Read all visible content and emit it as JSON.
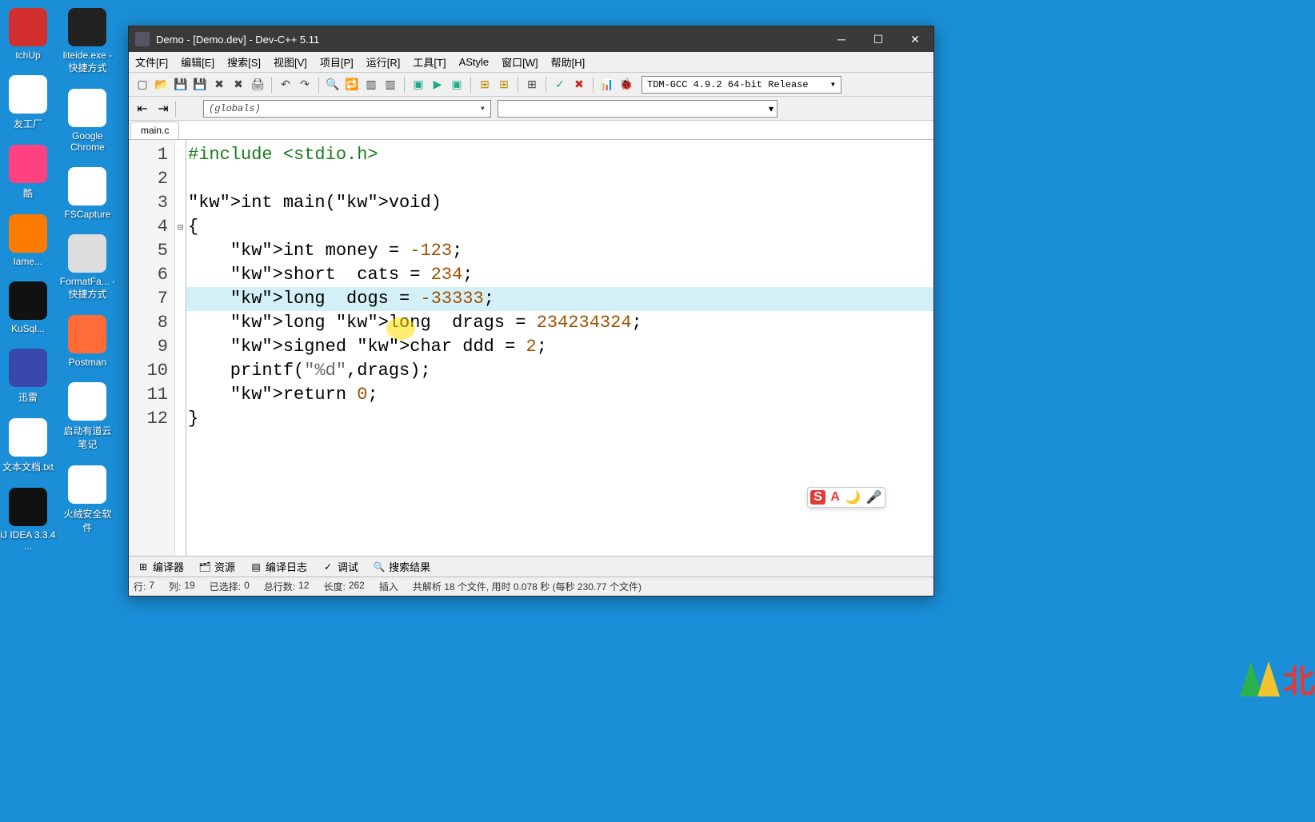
{
  "desktop": {
    "col1": [
      {
        "label": "tchUp",
        "color": "#d32f2f"
      },
      {
        "label": "友工厂",
        "color": "#ffffff"
      },
      {
        "label": "酷",
        "color": "#ff4081"
      },
      {
        "label": "lame...",
        "color": "#ff7b00"
      },
      {
        "label": "KuSql...",
        "color": "#111"
      },
      {
        "label": "迅雷",
        "color": "#3949ab"
      },
      {
        "label": "文本文档.txt",
        "color": "#fff"
      },
      {
        "label": "iJ IDEA 3.3.4 ...",
        "color": "#111"
      }
    ],
    "col2": [
      {
        "label": "liteide.exe - 快捷方式",
        "color": "#222"
      },
      {
        "label": "Google Chrome",
        "color": "#fff"
      },
      {
        "label": "FSCapture",
        "color": "#fff"
      },
      {
        "label": "FormatFa... - 快捷方式",
        "color": "#ddd"
      },
      {
        "label": "Postman",
        "color": "#ff6c37"
      },
      {
        "label": "启动有道云笔记",
        "color": "#fff"
      },
      {
        "label": "火绒安全软件",
        "color": "#fff"
      }
    ]
  },
  "ide": {
    "title": "Demo - [Demo.dev] - Dev-C++ 5.11",
    "menus": [
      "文件[F]",
      "编辑[E]",
      "搜索[S]",
      "视图[V]",
      "项目[P]",
      "运行[R]",
      "工具[T]",
      "AStyle",
      "窗口[W]",
      "帮助[H]"
    ],
    "compiler_combo": "TDM-GCC 4.9.2 64-bit Release",
    "globals_combo": "(globals)",
    "tab": "main.c",
    "code_lines": [
      {
        "n": 1,
        "raw": "#include <stdio.h>"
      },
      {
        "n": 2,
        "raw": ""
      },
      {
        "n": 3,
        "raw": "int main(void)"
      },
      {
        "n": 4,
        "raw": "{"
      },
      {
        "n": 5,
        "raw": "    int money = -123;"
      },
      {
        "n": 6,
        "raw": "    short  cats = 234;"
      },
      {
        "n": 7,
        "raw": "    long  dogs = -33333;"
      },
      {
        "n": 8,
        "raw": "    long long  drags = 234234324;"
      },
      {
        "n": 9,
        "raw": "    signed char ddd = 2;"
      },
      {
        "n": 10,
        "raw": "    printf(\"%d\",drags);"
      },
      {
        "n": 11,
        "raw": "    return 0;"
      },
      {
        "n": 12,
        "raw": "}"
      }
    ],
    "highlighted_line": 7,
    "bottom_tabs": [
      {
        "icon": "⊞",
        "label": "编译器"
      },
      {
        "icon": "🗂",
        "label": "资源"
      },
      {
        "icon": "▤",
        "label": "编译日志"
      },
      {
        "icon": "✓",
        "label": "调试"
      },
      {
        "icon": "🔍",
        "label": "搜索结果"
      }
    ],
    "status": {
      "line_label": "行:",
      "line": "7",
      "col_label": "列:",
      "col": "19",
      "sel_label": "已选择:",
      "sel": "0",
      "total_label": "总行数:",
      "total": "12",
      "len_label": "长度:",
      "len": "262",
      "mode": "插入",
      "parse": "共解析 18 个文件, 用时 0.078 秒 (每秒 230.77 个文件)"
    },
    "ime": {
      "s": "S",
      "a": "A",
      "moon": "🌙",
      "mic": "🎤"
    }
  },
  "corner_text": "北"
}
